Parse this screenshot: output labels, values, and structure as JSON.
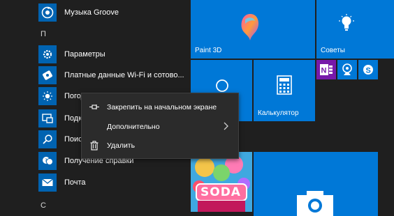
{
  "apps": [
    {
      "label": "Музыка Groove",
      "icon": "groove-music-icon"
    },
    {
      "label": "Параметры",
      "icon": "gear-icon"
    },
    {
      "label": "Платные данные Wi-Fi и сотово...",
      "icon": "wifi-data-icon"
    },
    {
      "label": "Погода",
      "icon": "weather-sun-icon"
    },
    {
      "label": "Подключить",
      "icon": "connect-icon"
    },
    {
      "label": "Поиск",
      "icon": "search-icon"
    },
    {
      "label": "Получение справки",
      "icon": "help-icon"
    },
    {
      "label": "Почта",
      "icon": "mail-icon"
    }
  ],
  "letters": {
    "p": "П",
    "s": "С"
  },
  "tiles": {
    "paint3d": "Paint 3D",
    "tips": "Советы",
    "calculator": "Калькулятор",
    "candy_word": "SODA"
  },
  "context_menu": {
    "pin": "Закрепить на начальном экране",
    "more": "Дополнительно",
    "delete": "Удалить"
  },
  "colors": {
    "tile": "#0078d7",
    "menu_bg": "#2b2b2b",
    "onenote": "#7719aa"
  }
}
